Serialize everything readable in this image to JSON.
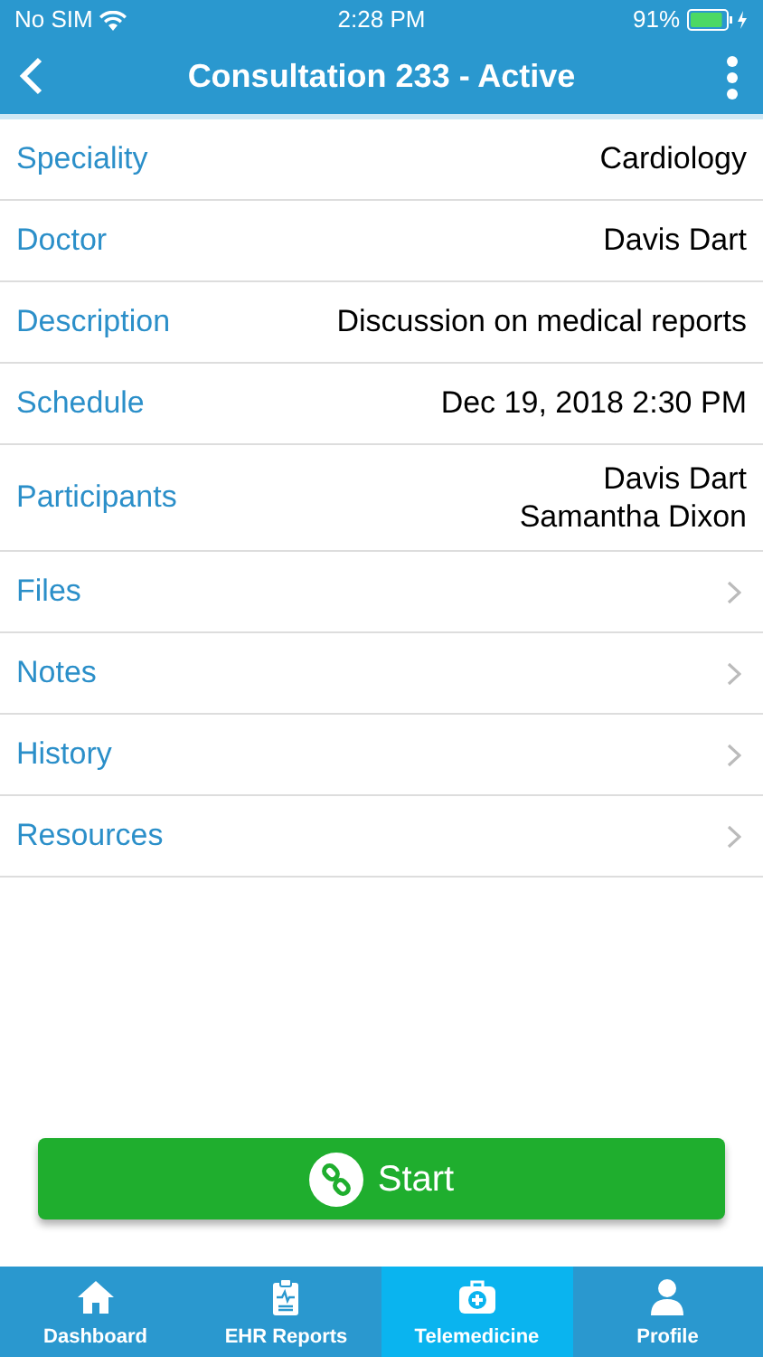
{
  "status_bar": {
    "carrier": "No SIM",
    "time": "2:28 PM",
    "battery": "91%",
    "battery_gauge": {
      "level": 0.91
    },
    "charging": true
  },
  "nav": {
    "title": "Consultation 233 - Active"
  },
  "details": [
    {
      "label": "Speciality",
      "values": [
        "Cardiology"
      ]
    },
    {
      "label": "Doctor",
      "values": [
        "Davis Dart"
      ]
    },
    {
      "label": "Description",
      "values": [
        "Discussion on medical reports"
      ]
    },
    {
      "label": "Schedule",
      "values": [
        "Dec 19, 2018 2:30 PM"
      ]
    },
    {
      "label": "Participants",
      "values": [
        "Davis Dart",
        "Samantha Dixon"
      ]
    }
  ],
  "links": [
    {
      "label": "Files"
    },
    {
      "label": "Notes"
    },
    {
      "label": "History"
    },
    {
      "label": "Resources"
    }
  ],
  "start_button": {
    "label": "Start"
  },
  "tabs": [
    {
      "label": "Dashboard",
      "kind": "home",
      "selected": false
    },
    {
      "label": "EHR Reports",
      "kind": "report",
      "selected": false
    },
    {
      "label": "Telemedicine",
      "kind": "kit",
      "selected": true
    },
    {
      "label": "Profile",
      "kind": "person",
      "selected": false
    }
  ]
}
